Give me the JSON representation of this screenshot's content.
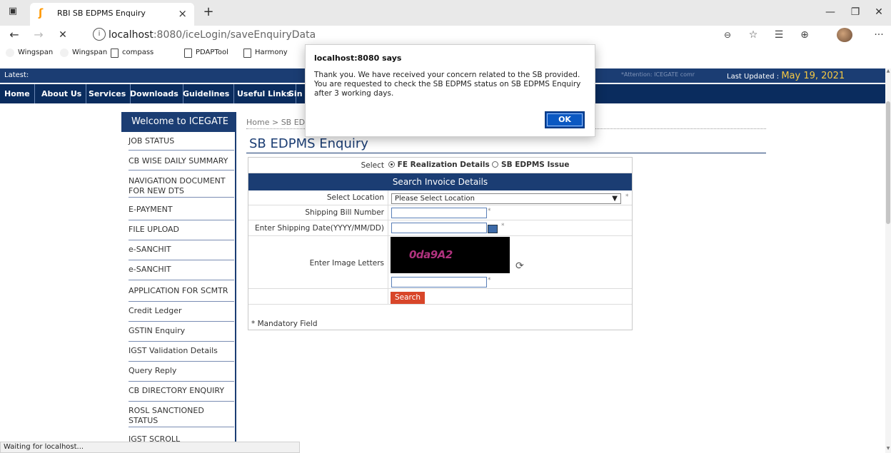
{
  "browser": {
    "tab_title": "RBI SB EDPMS Enquiry",
    "tab_close": "×",
    "new_tab": "+",
    "url_host": "localhost",
    "url_path": ":8080/iceLogin/saveEnquiryData",
    "back": "←",
    "forward": "→",
    "stop": "✕",
    "window_min": "—",
    "window_max": "❐",
    "window_close": "✕",
    "favorites": [
      "Wingspan",
      "Wingspan",
      "compass",
      "PDAPTool",
      "Harmony"
    ]
  },
  "site": {
    "latest_label": "Latest:",
    "attention": "*Attention: ICEGATE comr",
    "last_updated_label": "Last Updated :",
    "last_updated_date": "May 19, 2021",
    "nav": [
      "Home",
      "About Us",
      "Services",
      "Downloads",
      "Guidelines",
      "Useful Links",
      "Sin"
    ]
  },
  "sidebar": {
    "welcome": "Welcome to ICEGATE",
    "items": [
      "JOB STATUS",
      "CB WISE DAILY SUMMARY",
      "NAVIGATION DOCUMENT FOR NEW DTS",
      "E-PAYMENT",
      "FILE UPLOAD",
      "e-SANCHIT",
      "e-SANCHIT",
      "APPLICATION FOR SCMTR",
      "Credit Ledger",
      "GSTIN Enquiry",
      "IGST Validation Details",
      "Query Reply",
      "CB DIRECTORY ENQUIRY",
      "ROSL SANCTIONED STATUS",
      "IGST SCROLL"
    ]
  },
  "main": {
    "breadcrumb": "Home > SB ED",
    "title": "SB EDPMS Enquiry",
    "select_label": "Select",
    "radio1": "FE Realization Details",
    "radio2": "SB EDPMS Issue",
    "search_header": "Search Invoice Details",
    "location_label": "Select Location",
    "location_value": "Please Select Location",
    "sb_number_label": "Shipping Bill Number",
    "date_label": "Enter Shipping Date(YYYY/MM/DD)",
    "image_label": "Enter Image Letters",
    "captcha_text": "0da9A2",
    "search_button": "Search",
    "mandatory": "* Mandatory Field",
    "req_star": "*"
  },
  "dialog": {
    "title": "localhost:8080 says",
    "message": "Thank you. We have received your concern related to the SB provided. You are requested to check the SB EDPMS status on SB EDPMS Enquiry after 3 working days.",
    "ok": "OK"
  },
  "status_bar": "Waiting for localhost..."
}
